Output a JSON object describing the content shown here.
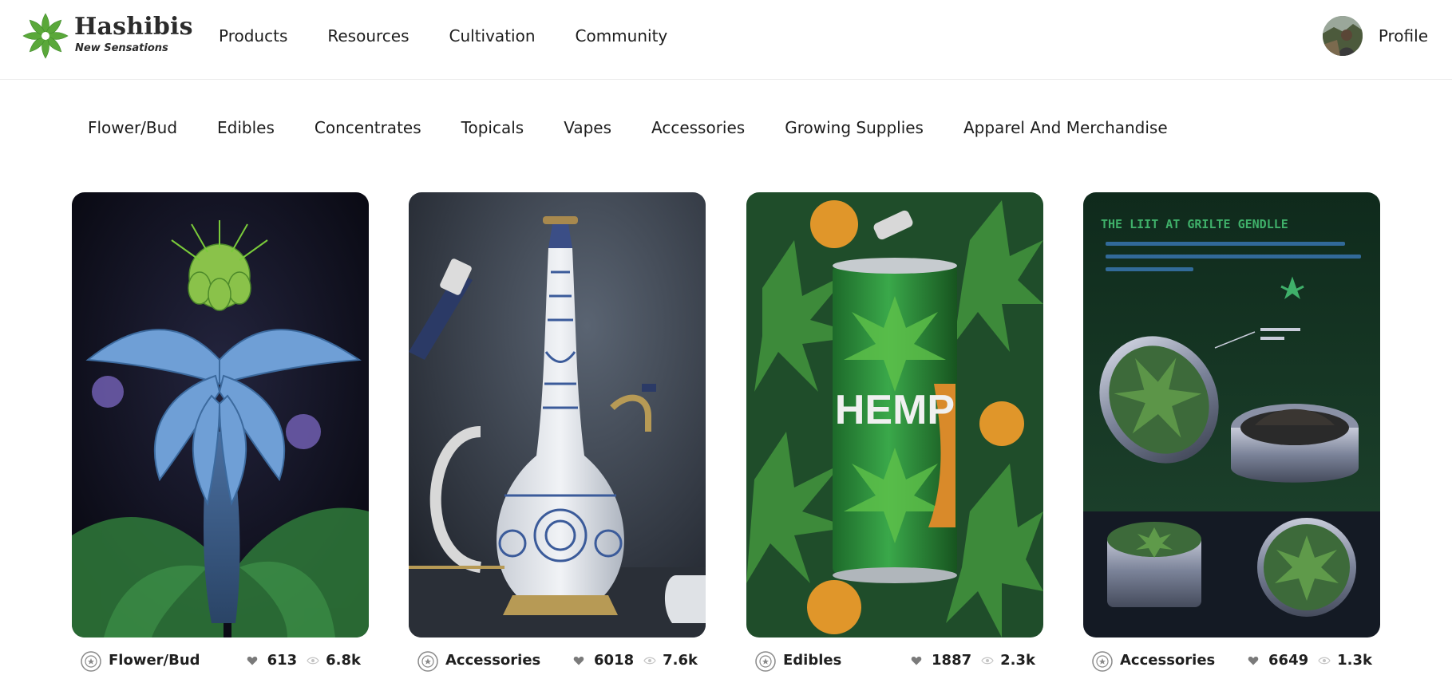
{
  "header": {
    "logo_title": "Hashibis",
    "logo_subtitle": "New Sensations",
    "nav": [
      "Products",
      "Resources",
      "Cultivation",
      "Community"
    ],
    "profile_label": "Profile"
  },
  "categories": [
    "Flower/Bud",
    "Edibles",
    "Concentrates",
    "Topicals",
    "Vapes",
    "Accessories",
    "Growing Supplies",
    "Apparel And Merchandise"
  ],
  "cards": [
    {
      "category": "Flower/Bud",
      "likes": "613",
      "views": "6.8k"
    },
    {
      "category": "Accessories",
      "likes": "6018",
      "views": "7.6k"
    },
    {
      "category": "Edibles",
      "likes": "1887",
      "views": "2.3k"
    },
    {
      "category": "Accessories",
      "likes": "6649",
      "views": "1.3k"
    }
  ],
  "card_images": {
    "can_label": "HEMP",
    "grinder_heading": "THE LIIT AT GRILTE GENDLLE"
  },
  "colors": {
    "brand_green": "#5aa83a",
    "text": "#1f1f1f",
    "border": "#ececec"
  },
  "icons": [
    "logo-leaf-icon",
    "category-badge-icon",
    "heart-icon",
    "eye-icon"
  ]
}
